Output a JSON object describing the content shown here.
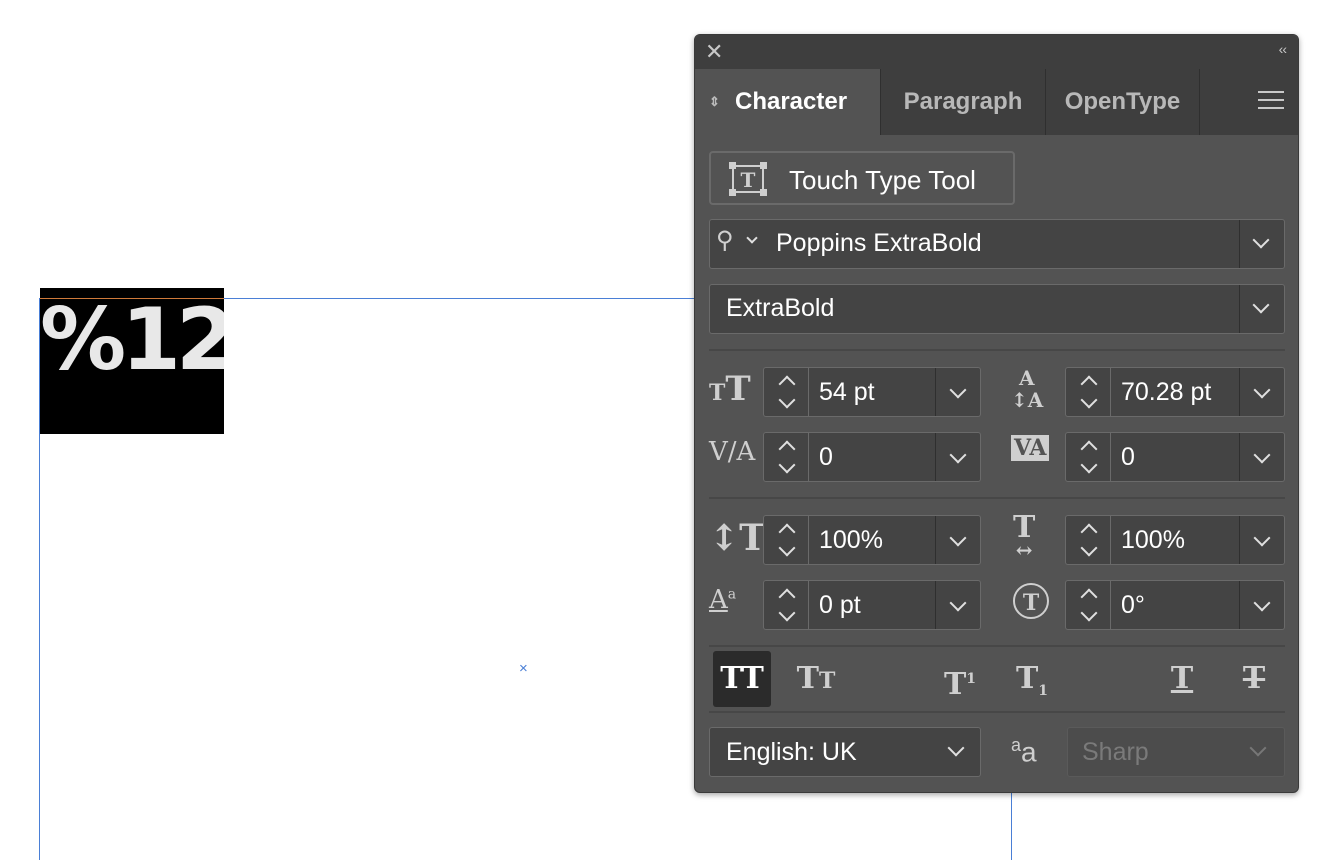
{
  "artboard": {
    "text": "%12"
  },
  "panel": {
    "tabs": [
      "Character",
      "Paragraph",
      "OpenType"
    ],
    "active_tab": "Character",
    "touch_type_label": "Touch Type Tool",
    "font_family": "Poppins ExtraBold",
    "font_style": "ExtraBold",
    "font_size": "54 pt",
    "leading": "70.28 pt",
    "kerning": "0",
    "tracking": "0",
    "vertical_scale": "100%",
    "horizontal_scale": "100%",
    "baseline_shift": "0 pt",
    "rotation": "0°",
    "language": "English: UK",
    "antialiasing": "Sharp"
  }
}
